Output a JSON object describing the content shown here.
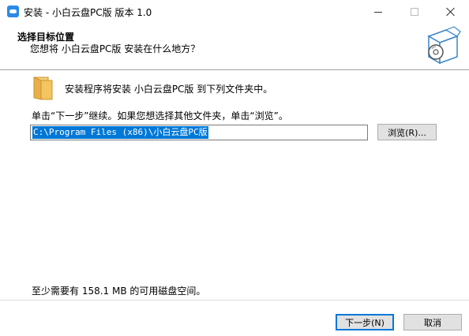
{
  "window": {
    "title": "安装 - 小白云盘PC版 版本 1.0",
    "icon": "cloud-app-icon"
  },
  "header": {
    "title": "选择目标位置",
    "subtitle": "您想将 小白云盘PC版 安装在什么地方？"
  },
  "body": {
    "info": "安装程序将安装 小白云盘PC版 到下列文件夹中。",
    "instruction": "单击“下一步”继续。如果您想选择其他文件夹，单击“浏览”。",
    "path_value": "C:\\Program Files (x86)\\小白云盘PC版",
    "browse_label": "浏览(R)...",
    "disk_space": "至少需要有 158.1 MB 的可用磁盘空间。"
  },
  "footer": {
    "next_label": "下一步(N)",
    "cancel_label": "取消"
  },
  "colors": {
    "selection": "#0078d7",
    "button_face": "#e1e1e1",
    "folder": "#e8b04a"
  }
}
